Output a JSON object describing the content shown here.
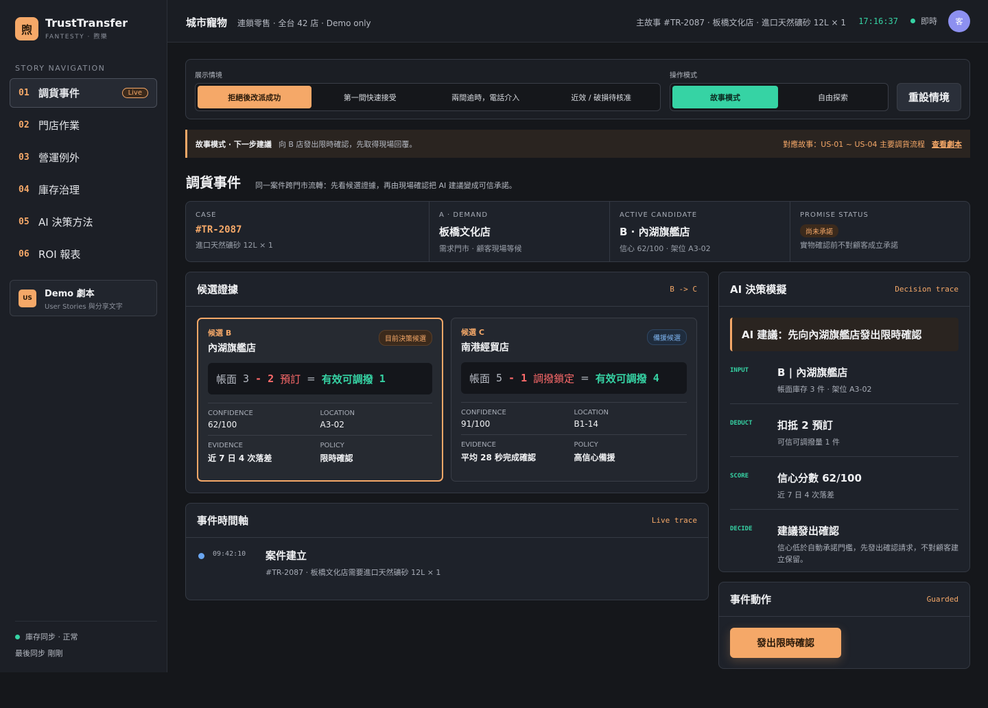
{
  "brand": {
    "logo_char": "煦",
    "name": "TrustTransfer",
    "sub": "FANTESTY · 煦樂"
  },
  "sidebar": {
    "nav_title": "STORY NAVIGATION",
    "items": [
      {
        "num": "01",
        "label": "調貨事件",
        "badge": "Live"
      },
      {
        "num": "02",
        "label": "門店作業"
      },
      {
        "num": "03",
        "label": "營運例外"
      },
      {
        "num": "04",
        "label": "庫存治理"
      },
      {
        "num": "05",
        "label": "AI 決策方法"
      },
      {
        "num": "06",
        "label": "ROI 報表"
      }
    ],
    "demo": {
      "badge": "US",
      "title": "Demo 劇本",
      "sub": "User Stories 與分享文字"
    },
    "footer": {
      "sync_status": "庫存同步 · 正常",
      "last_sync": "最後同步 剛剛"
    }
  },
  "topbar": {
    "title": "城市寵物",
    "subtitle": "連鎖零售 · 全台 42 店 · Demo only",
    "story": "主故事 #TR-2087 · 板橋文化店 · 進口天然礦砂 12L × 1",
    "time": "17:16:37",
    "live": "即時",
    "avatar": "客"
  },
  "controls": {
    "scenario_label": "展示情境",
    "scenarios": [
      "拒絕後改派成功",
      "第一間快速接受",
      "兩間逾時，電話介入",
      "近效 / 破損待核准"
    ],
    "mode_label": "操作模式",
    "modes": [
      "故事模式",
      "自由探索"
    ],
    "reset": "重設情境"
  },
  "hint": {
    "strong": "故事模式 · 下一步建議",
    "text": "向 B 店發出限時確認，先取得現場回覆。",
    "story_ref": "對應故事：US-01 ~ US-04 主要調貨流程",
    "link": "查看劇本"
  },
  "section": {
    "title": "調貨事件",
    "subtitle": "同一案件跨門市流轉：先看候選證據，再由現場確認把 AI 建議變成可信承諾。"
  },
  "info": {
    "case": {
      "label": "CASE",
      "value": "#TR-2087",
      "note": "進口天然礦砂 12L × 1"
    },
    "demand": {
      "label": "A · DEMAND",
      "value": "板橋文化店",
      "note": "需求門市 · 顧客現場等候"
    },
    "candidate": {
      "label": "ACTIVE CANDIDATE",
      "value": "B · 內湖旗艦店",
      "note": "信心 62/100 · 架位 A3-02"
    },
    "promise": {
      "label": "PROMISE STATUS",
      "pill": "尚未承諾",
      "note": "實物確認前不對顧客成立承諾"
    }
  },
  "evidence": {
    "title": "候選證據",
    "tag": "B -> C",
    "candidates": [
      {
        "kicker": "候選 B",
        "name": "內湖旗艦店",
        "badge": "目前決策候選",
        "f_book": "帳面",
        "f_book_n": "3",
        "f_minus": "-",
        "f_sub_n": "2",
        "f_sub": "預訂",
        "f_eq": "=",
        "f_res": "有效可調撥",
        "f_res_n": "1",
        "confidence_label": "CONFIDENCE",
        "confidence": "62/100",
        "location_label": "LOCATION",
        "location": "A3-02",
        "evidence_label": "EVIDENCE",
        "evidence": "近 7 日 4 次落差",
        "policy_label": "POLICY",
        "policy": "限時確認"
      },
      {
        "kicker": "候選 C",
        "name": "南港經貿店",
        "badge": "備援候選",
        "f_book": "帳面",
        "f_book_n": "5",
        "f_minus": "-",
        "f_sub_n": "1",
        "f_sub": "調撥鎖定",
        "f_eq": "=",
        "f_res": "有效可調撥",
        "f_res_n": "4",
        "confidence_label": "CONFIDENCE",
        "confidence": "91/100",
        "location_label": "LOCATION",
        "location": "B1-14",
        "evidence_label": "EVIDENCE",
        "evidence": "平均 28 秒完成確認",
        "policy_label": "POLICY",
        "policy": "高信心備援"
      }
    ]
  },
  "timeline": {
    "title": "事件時間軸",
    "tag": "Live trace",
    "events": [
      {
        "time": "09:42:10",
        "title": "案件建立",
        "desc": "#TR-2087 · 板橋文化店需要進口天然礦砂 12L × 1"
      }
    ]
  },
  "ai": {
    "title": "AI 決策模擬",
    "tag": "Decision trace",
    "recommendation": "AI 建議：先向內湖旗艦店發出限時確認",
    "steps": [
      {
        "key": "INPUT",
        "head": "B | 內湖旗艦店",
        "desc": "帳面庫存 3 件 · 架位 A3-02"
      },
      {
        "key": "DEDUCT",
        "head": "扣抵 2 預訂",
        "desc": "可信可調撥量 1 件"
      },
      {
        "key": "SCORE",
        "head": "信心分數 62/100",
        "desc": "近 7 日 4 次落差"
      },
      {
        "key": "DECIDE",
        "head": "建議發出確認",
        "desc": "信心低於自動承諾門檻，先發出確認請求，不對顧客建立保留。"
      }
    ]
  },
  "actions": {
    "title": "事件動作",
    "tag": "Guarded",
    "button": "發出限時確認"
  },
  "colors": {
    "accent": "#f5a868",
    "teal": "#36d3a4",
    "danger": "#ff6b6b",
    "bg": "#15171b"
  },
  "icons": {
    "sync_status": "green-dot-icon",
    "timeline_event": "blue-dot-icon"
  }
}
